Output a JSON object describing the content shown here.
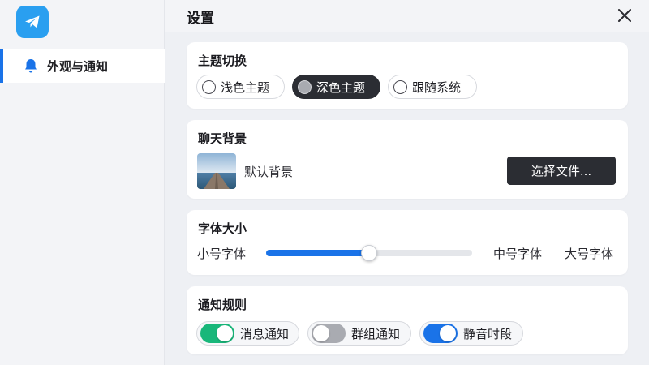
{
  "header": {
    "title": "设置",
    "close_icon": "close-icon"
  },
  "sidebar": {
    "logo_icon": "telegram-logo-icon",
    "items": [
      {
        "label": "外观与通知",
        "icon": "bell-icon",
        "active": true
      }
    ]
  },
  "theme": {
    "title": "主题切换",
    "options": [
      {
        "label": "浅色主题",
        "selected": false
      },
      {
        "label": "深色主题",
        "selected": true
      },
      {
        "label": "跟随系统",
        "selected": false
      }
    ]
  },
  "chat_bg": {
    "title": "聊天背景",
    "current": "默认背景",
    "choose_button": "选择文件..."
  },
  "font_size": {
    "title": "字体大小",
    "small": "小号字体",
    "medium": "中号字体",
    "large": "大号字体",
    "slider_level": 0.5
  },
  "notify": {
    "title": "通知规则",
    "toggles": [
      {
        "label": "消息通知",
        "on": true,
        "color": "#19b77a"
      },
      {
        "label": "群组通知",
        "on": false,
        "color": "#a9abb1"
      },
      {
        "label": "静音时段",
        "on": true,
        "color": "#1a73e8"
      }
    ]
  }
}
